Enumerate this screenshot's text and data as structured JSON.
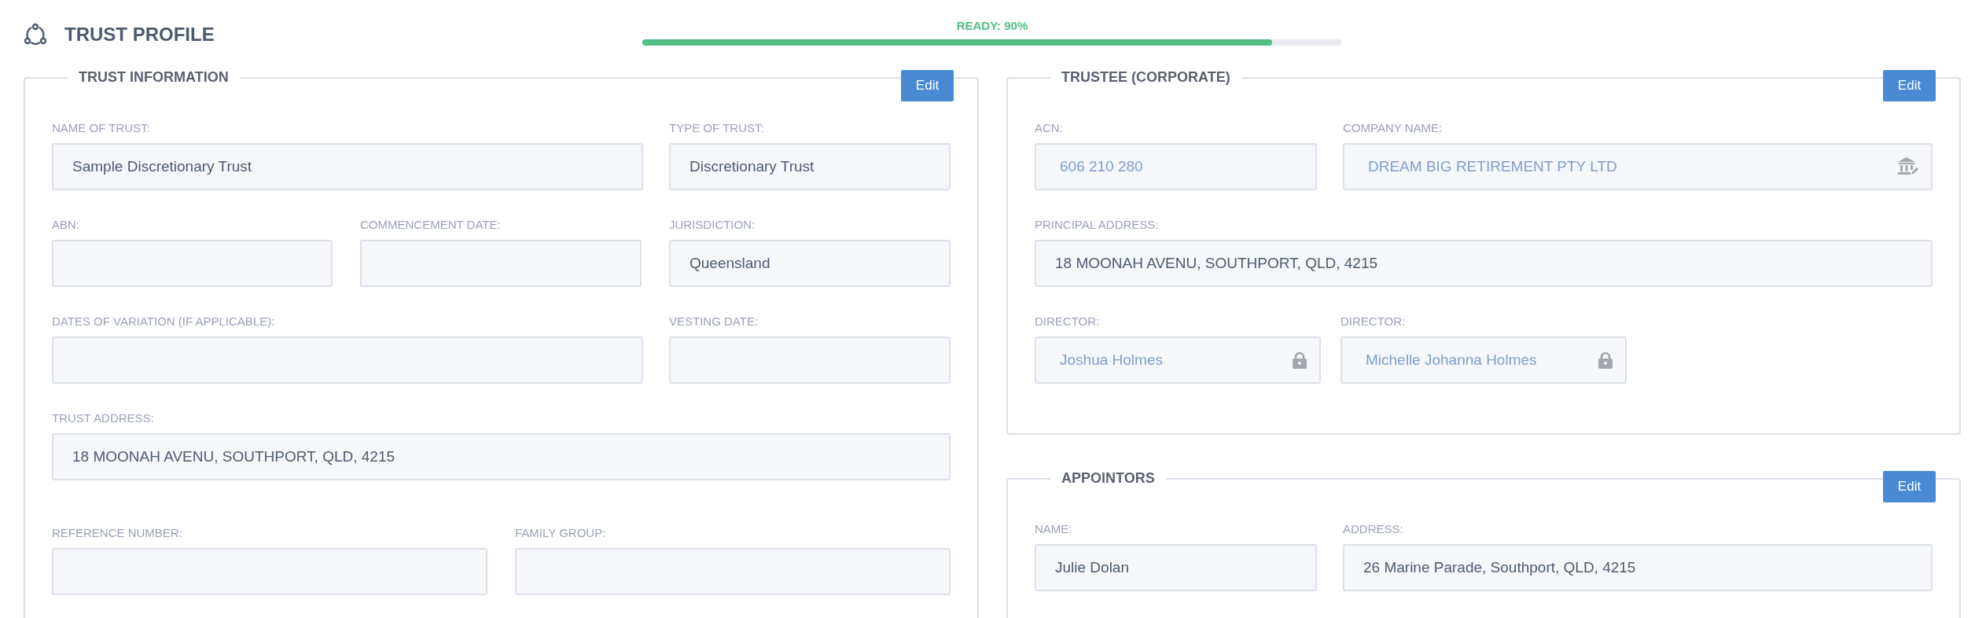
{
  "header": {
    "title": "TRUST PROFILE"
  },
  "progress": {
    "label": "READY: 90%",
    "level": 0.9
  },
  "sections": [
    {
      "title": "TRUST INFORMATION",
      "button": "Edit",
      "rows": [
        [
          {
            "label": "NAME OF TRUST:",
            "value": "Sample Discretionary Trust",
            "kind": "plain"
          },
          {
            "label": "TYPE OF TRUST:",
            "value": "Discretionary Trust",
            "kind": "plain"
          }
        ],
        [
          {
            "label": "ABN:",
            "kind": "plain"
          },
          {
            "label": "COMMENCEMENT DATE:",
            "kind": "plain"
          },
          {
            "label": "JURISDICTION:",
            "value": "Queensland",
            "kind": "plain"
          }
        ],
        [
          {
            "label": "DATES OF VARIATION (IF APPLICABLE):",
            "kind": "plain"
          },
          {
            "label": "VESTING DATE:",
            "kind": "plain"
          }
        ],
        [
          {
            "label": "TRUST ADDRESS:",
            "value": "18 MOONAH AVENU, SOUTHPORT, QLD, 4215",
            "kind": "plain"
          }
        ],
        [
          {
            "label": "REFERENCE NUMBER:",
            "kind": "plain"
          },
          {
            "label": "FAMILY GROUP:",
            "kind": "plain"
          }
        ]
      ]
    },
    {
      "title": "TRUSTEE (CORPORATE)",
      "button": "Edit",
      "rows": [
        [
          {
            "label": "ACN:",
            "value": "606 210 280",
            "kind": "readonly"
          },
          {
            "label": "COMPANY NAME:",
            "value": "DREAM BIG RETIREMENT PTY LTD",
            "kind": "linked"
          }
        ],
        [
          {
            "label": "PRINCIPAL ADDRESS:",
            "value": "18 MOONAH AVENU, SOUTHPORT, QLD, 4215",
            "kind": "plain"
          }
        ],
        [
          {
            "label": "DIRECTOR:",
            "value": "Joshua Holmes",
            "kind": "locked"
          },
          {
            "label": "DIRECTOR:",
            "value": "Michelle Johanna Holmes",
            "kind": "locked"
          }
        ]
      ]
    },
    {
      "title": "APPOINTORS",
      "button": "Edit",
      "rows": [
        [
          {
            "label": "NAME:",
            "value": "Julie Dolan",
            "kind": "plain"
          },
          {
            "label": "ADDRESS:",
            "value": "26 Marine Parade, Southport, QLD, 4215",
            "kind": "plain"
          }
        ]
      ]
    }
  ]
}
